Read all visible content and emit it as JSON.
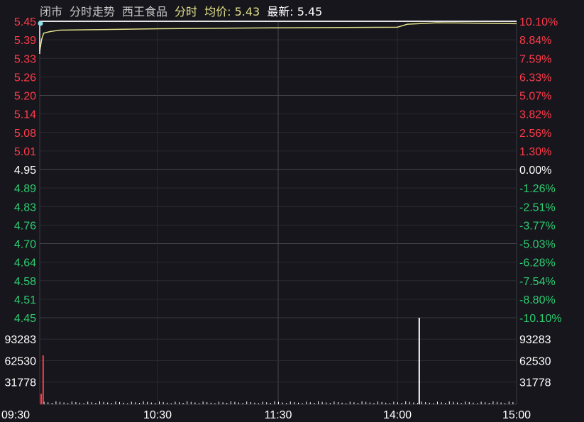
{
  "header": {
    "status": "闭市",
    "view": "分时走势",
    "stock_name": "西王食品",
    "mode": "分时",
    "avg_label": "均价:",
    "avg_value": "5.43",
    "latest_label": "最新:",
    "latest_value": "5.45"
  },
  "colors": {
    "background": "#16161c",
    "grid": "#3a3a42",
    "up": "#ff3b4a",
    "down": "#2ecc71",
    "neutral": "#ffffff",
    "price_line": "#ffffff",
    "avg_line": "#e3e08a",
    "header_muted": "#c8c8c8",
    "header_accent": "#e3e08a"
  },
  "chart_data": {
    "type": "line",
    "price_axis": {
      "ticks": [
        "5.45",
        "5.39",
        "5.33",
        "5.26",
        "5.20",
        "5.14",
        "5.08",
        "5.01",
        "4.95",
        "4.89",
        "4.83",
        "4.76",
        "4.70",
        "4.64",
        "4.58",
        "4.51",
        "4.45"
      ],
      "range": [
        4.45,
        5.45
      ],
      "base": 4.95
    },
    "pct_axis": {
      "ticks": [
        "10.10%",
        "8.84%",
        "7.59%",
        "6.33%",
        "5.07%",
        "3.82%",
        "2.56%",
        "1.30%",
        "0.00%",
        "-1.26%",
        "-2.51%",
        "-3.77%",
        "-5.03%",
        "-6.28%",
        "-7.54%",
        "-8.80%",
        "-10.10%"
      ]
    },
    "volume_axis": {
      "ticks": [
        "93283",
        "62530",
        "31778"
      ],
      "max": 124035
    },
    "time_axis": {
      "ticks": [
        "09:30",
        "10:30",
        "11:30",
        "14:00",
        "15:00"
      ],
      "minutes": 240
    },
    "price_series": [
      [
        0,
        5.34
      ],
      [
        0,
        5.45
      ],
      [
        1,
        5.45
      ],
      [
        240,
        5.45
      ]
    ],
    "avg_series": [
      [
        0,
        5.35
      ],
      [
        1,
        5.39
      ],
      [
        2,
        5.41
      ],
      [
        5,
        5.415
      ],
      [
        10,
        5.42
      ],
      [
        30,
        5.422
      ],
      [
        60,
        5.425
      ],
      [
        120,
        5.428
      ],
      [
        180,
        5.43
      ],
      [
        185,
        5.44
      ],
      [
        200,
        5.445
      ],
      [
        240,
        5.442
      ]
    ],
    "volume": {
      "up": [
        [
          0,
          15000
        ],
        [
          1,
          70000
        ]
      ],
      "spike": [
        [
          186,
          124000
        ]
      ],
      "low_level": 3000
    }
  }
}
